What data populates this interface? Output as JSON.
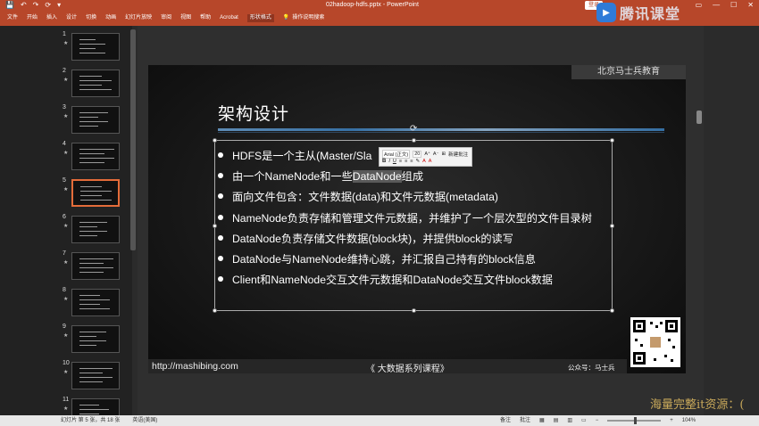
{
  "titlebar": {
    "quick_access": [
      "💾",
      "↶",
      "↷",
      "⟳",
      "▾"
    ],
    "doc_title": "02hadoop-hdfs.pptx - PowerPoint",
    "signin": "登录",
    "controls": [
      "▭",
      "—",
      "☐",
      "✕"
    ]
  },
  "ribbon": {
    "tabs": [
      "文件",
      "开始",
      "插入",
      "设计",
      "切换",
      "动画",
      "幻灯片放映",
      "审阅",
      "视图",
      "帮助",
      "Acrobat",
      "形状格式"
    ],
    "active_tab": "形状格式",
    "tellme": "操作说明搜索",
    "watermark_text": "腾讯课堂"
  },
  "thumbnails": [
    {
      "num": "1",
      "star": "★"
    },
    {
      "num": "2",
      "star": "★"
    },
    {
      "num": "3",
      "star": "★"
    },
    {
      "num": "4",
      "star": "★"
    },
    {
      "num": "5",
      "star": "★"
    },
    {
      "num": "6",
      "star": "★"
    },
    {
      "num": "7",
      "star": "★"
    },
    {
      "num": "8",
      "star": "★"
    },
    {
      "num": "9",
      "star": "★"
    },
    {
      "num": "10",
      "star": "★"
    },
    {
      "num": "11",
      "star": "★"
    }
  ],
  "slide": {
    "brand": "北京马士兵教育",
    "title": "架构设计",
    "bullets": [
      "HDFS是一个主从(Master/Sla",
      "由一个NameNode和一些",
      "面向文件包含：文件数据(data)和文件元数据(metadata)",
      "NameNode负责存储和管理文件元数据，并维护了一个层次型的文件目录树",
      "DataNode负责存储文件数据(block块)，并提供block的读写",
      "DataNode与NameNode维持心跳，并汇报自己持有的block信息",
      "Client和NameNode交互文件元数据和DataNode交互文件block数据"
    ],
    "selected_text": "DataNode",
    "after_selected": "组成",
    "footer_url": "http://mashibing.com",
    "footer_course": "《 大数据系列课程》",
    "footer_account": "公众号：马士兵"
  },
  "minitoolbar": {
    "font": "Arial (正文)",
    "size": "20",
    "row1_tools": [
      "A⁺",
      "A⁻",
      "⊞"
    ],
    "row2_tools": [
      "B",
      "I",
      "U",
      "≡",
      "≡",
      "≡",
      "✎",
      "A",
      "A"
    ],
    "new_comment": "新建批注"
  },
  "statusbar": {
    "slide_info": "幻灯片 第 5 张，共 18 张",
    "lang": "英语(美国)",
    "notes": "备注",
    "comments": "批注",
    "zoom": "104%"
  },
  "overlay_watermark": "海量完整it资源：("
}
